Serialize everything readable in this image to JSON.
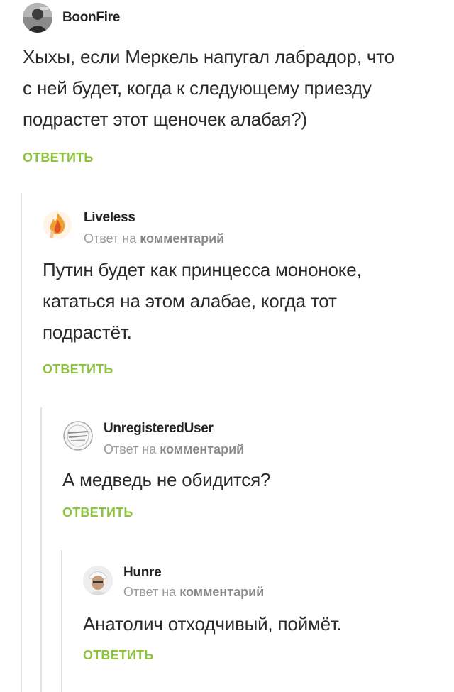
{
  "colors": {
    "reply_green": "#8cc43c",
    "text": "#2b2b2b",
    "meta_gray": "#9a9a9a",
    "thread_line": "#e2e2e2"
  },
  "comments": [
    {
      "author": "BoonFire",
      "avatar_icon": "user-avatar-icon",
      "reply_meta": null,
      "lines": [
        "Хыхы, если Меркель напугал лабрадор, что",
        "с ней будет, когда к следующему приезду",
        "подрастет этот щеночек алабая?)"
      ],
      "reply_label": "ОТВЕТИТЬ"
    },
    {
      "author": "Liveless",
      "avatar_icon": "flame-hand-avatar-icon",
      "reply_meta": {
        "prefix": "Ответ на",
        "link": "комментарий"
      },
      "lines": [
        "Путин будет как принцесса мононоке,",
        "кататься на этом алабае, когда тот",
        "подрастёт."
      ],
      "reply_label": "ОТВЕТИТЬ"
    },
    {
      "author": "UnregisteredUser",
      "avatar_icon": "stamp-avatar-icon",
      "reply_meta": {
        "prefix": "Ответ на",
        "link": "комментарий"
      },
      "lines": [
        "А медведь не обидится?"
      ],
      "reply_label": "ОТВЕТИТЬ"
    },
    {
      "author": "Hunre",
      "avatar_icon": "man-photo-avatar-icon",
      "reply_meta": {
        "prefix": "Ответ на",
        "link": "комментарий"
      },
      "lines": [
        "Анатолич отходчивый, поймёт."
      ],
      "reply_label": "ОТВЕТИТЬ"
    }
  ]
}
